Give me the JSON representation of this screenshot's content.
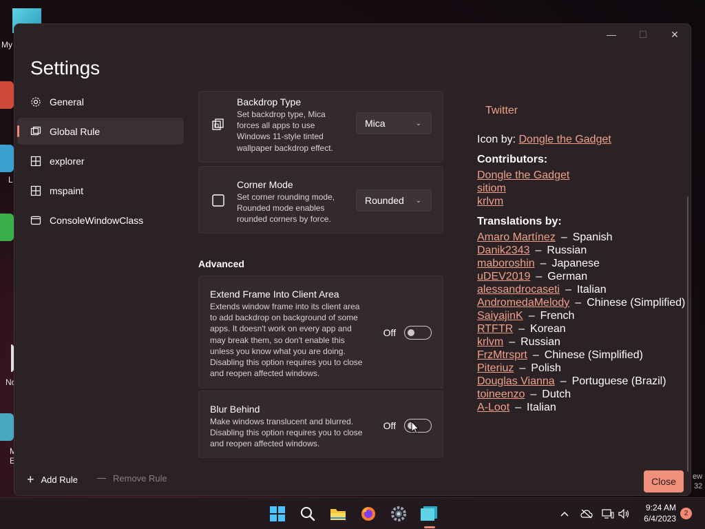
{
  "desktop": {
    "icon_label_1": "My",
    "icon_label_2": "L",
    "icon_label_3": "No",
    "icon_label_4": "M",
    "icon_label_5": "E",
    "right_label_1": "ew",
    "right_label_2": "32"
  },
  "window": {
    "title": "Settings",
    "controls": {
      "minimize": "—",
      "maximize": "☐",
      "close": "✕"
    }
  },
  "sidebar": {
    "items": [
      {
        "label": "General",
        "icon": "gear-icon"
      },
      {
        "label": "Global Rule",
        "icon": "window-icon",
        "selected": true
      },
      {
        "label": "explorer",
        "icon": "app-icon"
      },
      {
        "label": "mspaint",
        "icon": "app-icon"
      },
      {
        "label": "ConsoleWindowClass",
        "icon": "window-icon"
      }
    ]
  },
  "settings": {
    "backdrop": {
      "title": "Backdrop Type",
      "desc_lines": [
        "Set backdrop type, Mica",
        "forces all apps to use",
        "Windows 11-style tinted",
        "wallpaper backdrop effect."
      ],
      "value": "Mica"
    },
    "corner": {
      "title": "Corner Mode",
      "desc_lines": [
        "Set corner rounding mode,",
        "Rounded mode enables",
        "rounded corners by force."
      ],
      "value": "Rounded"
    },
    "advanced_header": "Advanced",
    "extend": {
      "title": "Extend Frame Into Client Area",
      "desc_lines": [
        "Extends window frame into its client area",
        "to add backdrop on background of some",
        "apps. It doesn't work on every app and",
        "may break them, so don't enable this",
        "unless you know what you are doing.",
        "Disabling this option requires you to close",
        "and reopen affected windows."
      ],
      "toggle_label": "Off"
    },
    "blur": {
      "title": "Blur Behind",
      "desc_lines": [
        "Make windows translucent and blurred.",
        "Disabling this option requires you to close",
        "and reopen affected windows."
      ],
      "toggle_label": "Off"
    }
  },
  "about": {
    "twitter": "Twitter",
    "icon_by_label": "Icon by:",
    "icon_by_name": "Dongle the Gadget",
    "contributors_header": "Contributors:",
    "contributors": [
      "Dongle the Gadget",
      "sitiom",
      "krlvm"
    ],
    "translations_header": "Translations by:",
    "translations": [
      {
        "name": "Amaro Martínez",
        "lang": "Spanish"
      },
      {
        "name": "Danik2343",
        "lang": "Russian"
      },
      {
        "name": "maboroshin",
        "lang": "Japanese"
      },
      {
        "name": "uDEV2019",
        "lang": "German"
      },
      {
        "name": "alessandrocaseti",
        "lang": "Italian"
      },
      {
        "name": "AndromedaMelody",
        "lang": "Chinese (Simplified)"
      },
      {
        "name": "SaiyajinK",
        "lang": "French"
      },
      {
        "name": "RTFTR",
        "lang": "Korean"
      },
      {
        "name": "krlvm",
        "lang": "Russian"
      },
      {
        "name": "FrzMtrsprt",
        "lang": "Chinese (Simplified)"
      },
      {
        "name": "Piteriuz",
        "lang": "Polish"
      },
      {
        "name": "Douglas Vianna",
        "lang": "Portuguese (Brazil)"
      },
      {
        "name": "toineenzo",
        "lang": "Dutch"
      },
      {
        "name": "A-Loot",
        "lang": "Italian"
      }
    ],
    "separator": "–"
  },
  "footer": {
    "add_rule": "Add Rule",
    "remove_rule": "Remove Rule",
    "close": "Close"
  },
  "taskbar": {
    "time": "9:24 AM",
    "date": "6/4/2023",
    "notifications": "2",
    "apps": [
      "start-icon",
      "search-icon",
      "file-explorer-icon",
      "firefox-icon",
      "settings-app-icon",
      "mica-app-icon"
    ]
  },
  "colors": {
    "accent": "#f08a74",
    "link": "#f0a088",
    "window_bg": "#2a2225",
    "card_bg": "#332a2e"
  }
}
